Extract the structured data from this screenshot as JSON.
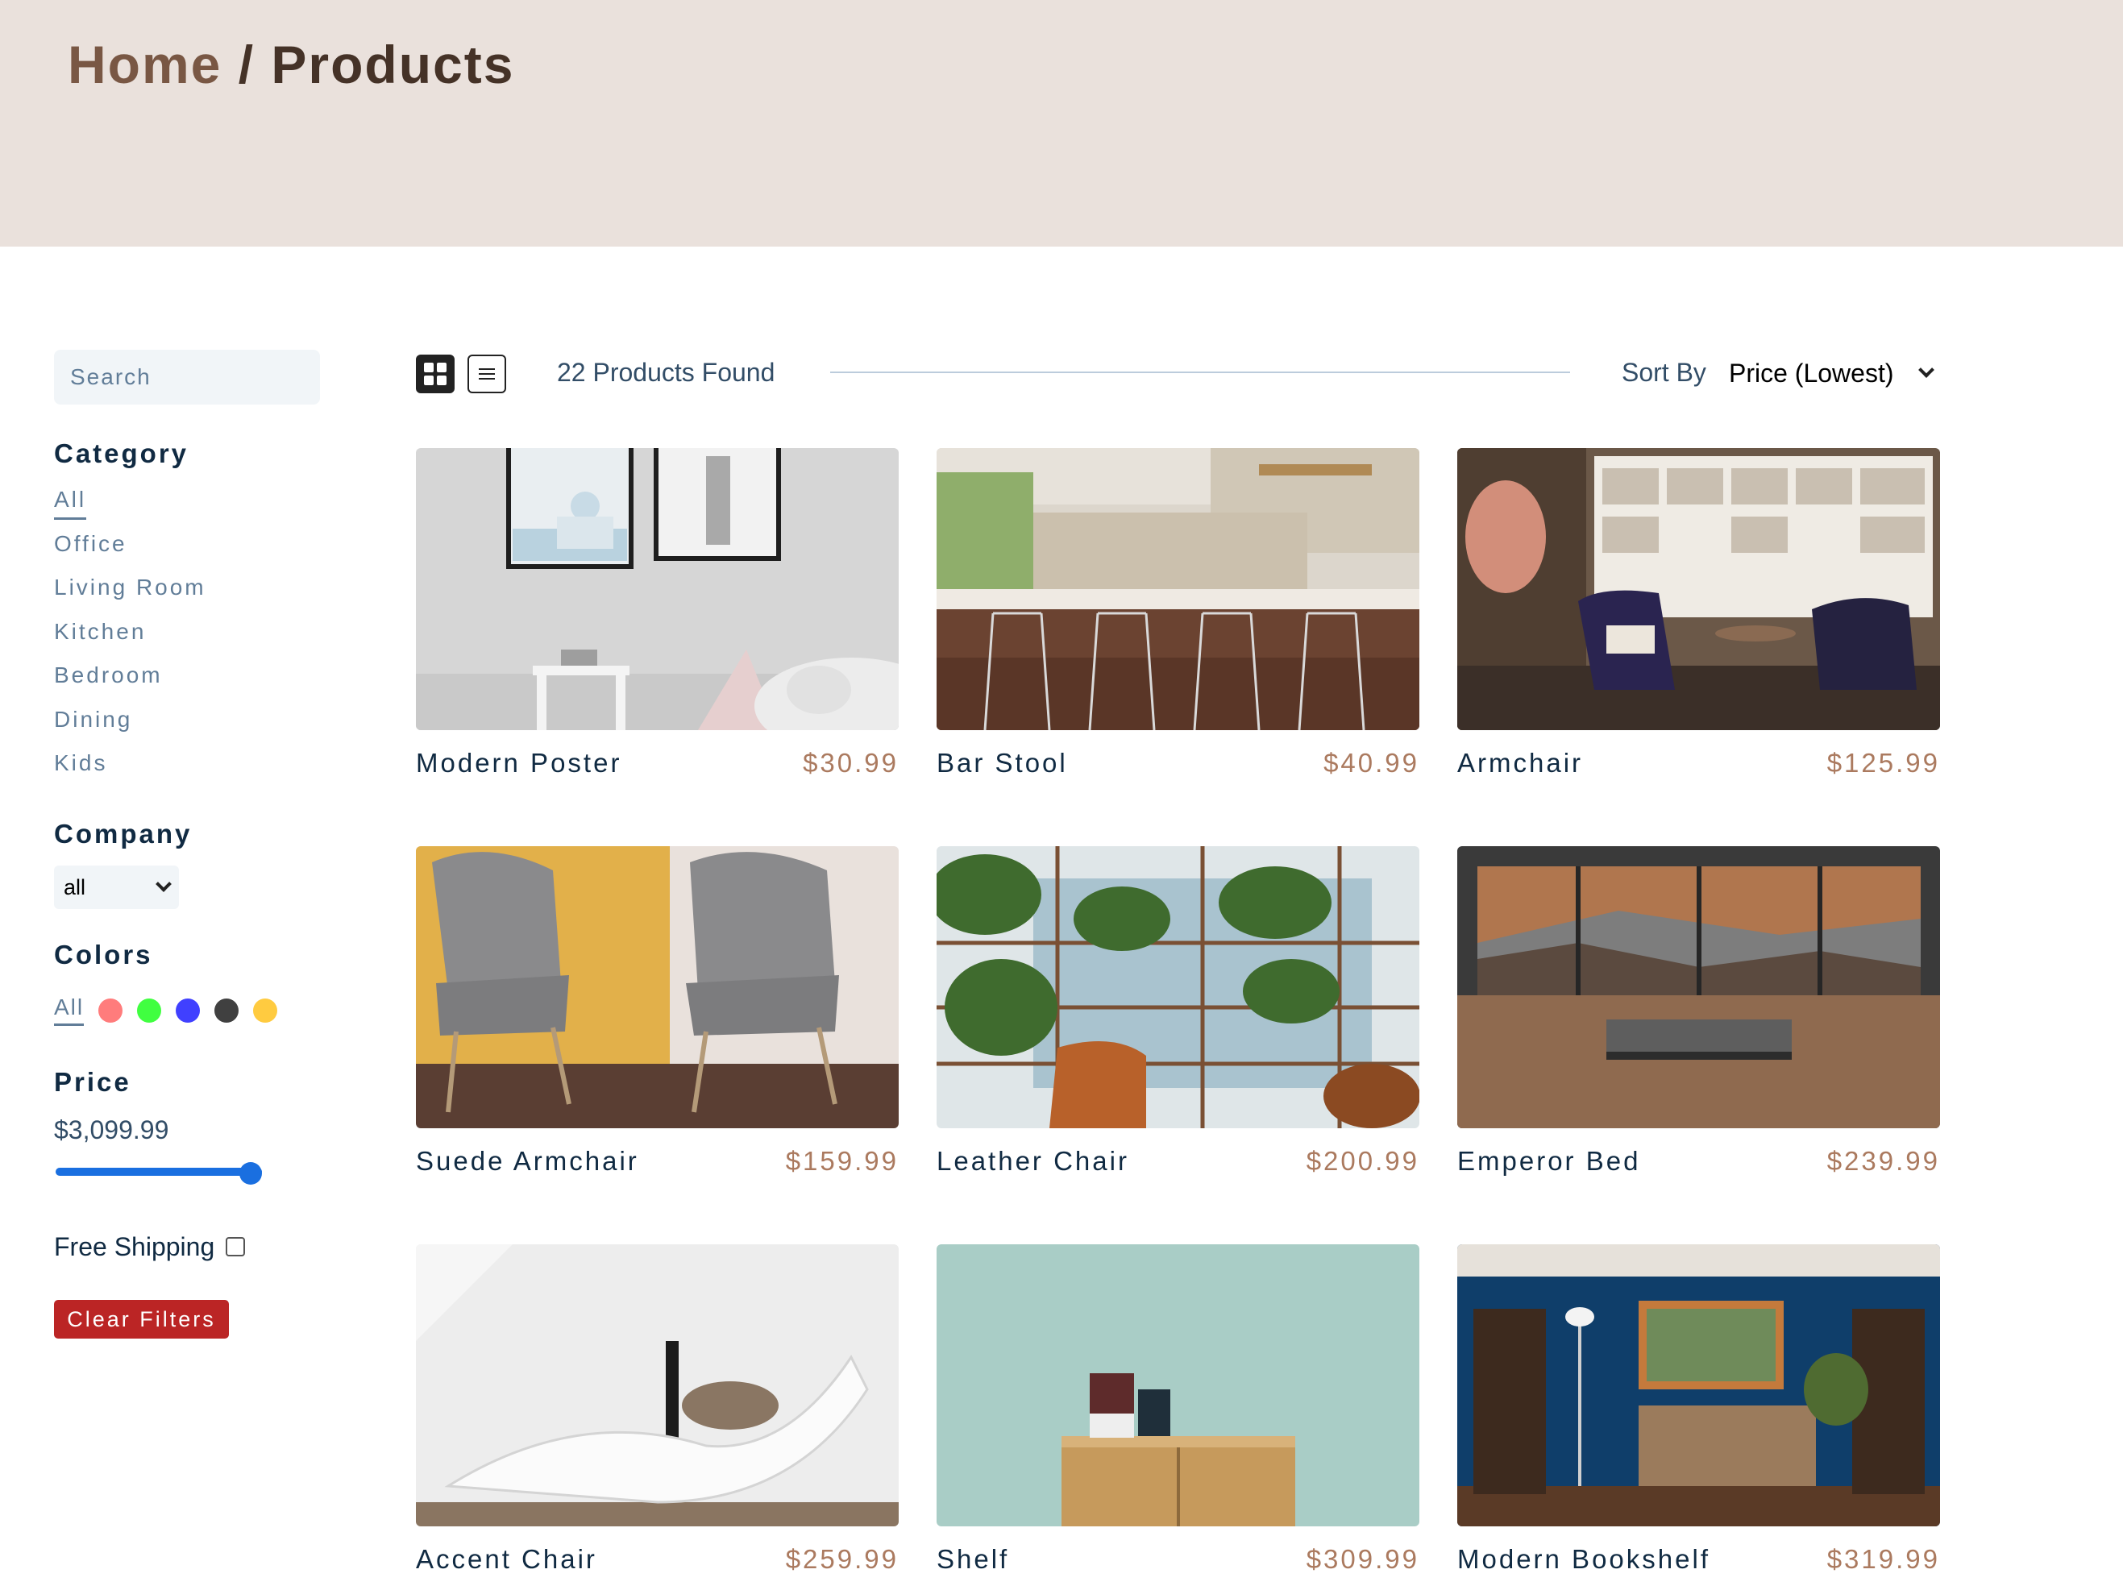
{
  "breadcrumb": {
    "home": "Home",
    "separator": " / ",
    "current": "Products"
  },
  "sidebar": {
    "search_placeholder": "Search",
    "category_heading": "Category",
    "categories": [
      "All",
      "Office",
      "Living Room",
      "Kitchen",
      "Bedroom",
      "Dining",
      "Kids"
    ],
    "active_category": "All",
    "company_heading": "Company",
    "company_selected": "all",
    "colors_heading": "Colors",
    "colors_all": "All",
    "colors": [
      "#ff5050",
      "#00ff00",
      "#0000ff",
      "#000000",
      "#ffb900"
    ],
    "price_heading": "Price",
    "price_value": "$3,099.99",
    "price_slider_fraction": 1.0,
    "free_shipping_label": "Free Shipping",
    "free_shipping_checked": false,
    "clear_filters_label": "Clear Filters"
  },
  "toolbar": {
    "products_found": "22 Products Found",
    "sort_label": "Sort By",
    "sort_selected": "Price (Lowest)"
  },
  "products": [
    {
      "name": "Modern Poster",
      "price": "$30.99",
      "image": "poster-wall"
    },
    {
      "name": "Bar Stool",
      "price": "$40.99",
      "image": "kitchen-stools"
    },
    {
      "name": "Armchair",
      "price": "$125.99",
      "image": "shelf-armchair"
    },
    {
      "name": "Suede Armchair",
      "price": "$159.99",
      "image": "grey-armchairs"
    },
    {
      "name": "Leather Chair",
      "price": "$200.99",
      "image": "plant-shelves"
    },
    {
      "name": "Emperor Bed",
      "price": "$239.99",
      "image": "mountain-bed"
    },
    {
      "name": "Accent Chair",
      "price": "$259.99",
      "image": "white-chaise"
    },
    {
      "name": "Shelf",
      "price": "$309.99",
      "image": "teal-shelf"
    },
    {
      "name": "Modern Bookshelf",
      "price": "$319.99",
      "image": "blue-bookshelf"
    }
  ]
}
